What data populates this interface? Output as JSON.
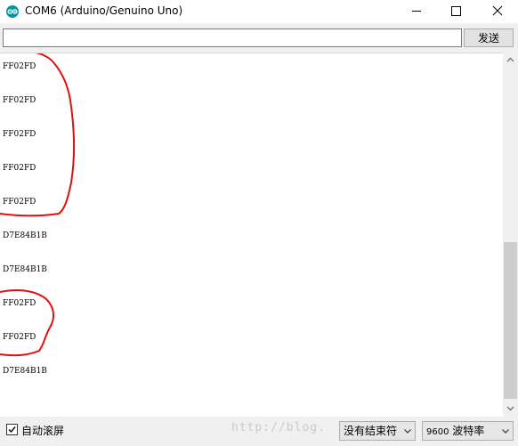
{
  "window": {
    "title": "COM6 (Arduino/Genuino Uno)"
  },
  "send": {
    "input_value": "",
    "button_label": "发送"
  },
  "output": {
    "lines": [
      "FF02FD",
      "FF02FD",
      "FF02FD",
      "FF02FD",
      "FF02FD",
      "D7E84B1B",
      "D7E84B1B",
      "FF02FD",
      "FF02FD",
      "D7E84B1B"
    ]
  },
  "footer": {
    "autoscroll_label": "自动滚屏",
    "autoscroll_checked": true,
    "watermark": "http://blog.",
    "line_ending": "没有结束符",
    "baud_rate": "9600",
    "baud_label": "波特率"
  },
  "colors": {
    "arduino_teal": "#00979c",
    "annotation_red": "#e01010",
    "scroll_thumb": "#cdcdcd"
  }
}
